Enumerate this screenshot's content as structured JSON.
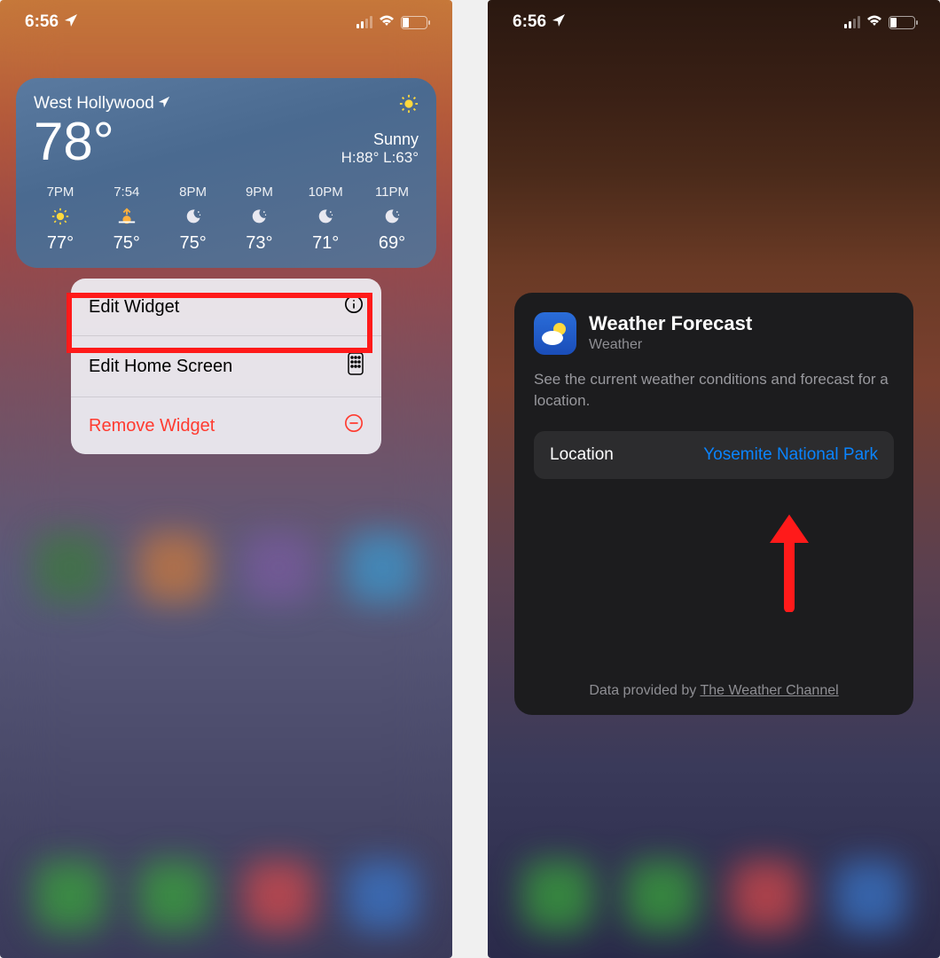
{
  "status": {
    "time": "6:56",
    "signal_active_bars": 2
  },
  "weather": {
    "location": "West Hollywood",
    "current_temp": "78°",
    "condition": "Sunny",
    "high": "H:88°",
    "low": "L:63°",
    "hourly": [
      {
        "time": "7PM",
        "icon": "sun",
        "temp": "77°"
      },
      {
        "time": "7:54",
        "icon": "sunset",
        "temp": "75°"
      },
      {
        "time": "8PM",
        "icon": "night",
        "temp": "75°"
      },
      {
        "time": "9PM",
        "icon": "night",
        "temp": "73°"
      },
      {
        "time": "10PM",
        "icon": "night",
        "temp": "71°"
      },
      {
        "time": "11PM",
        "icon": "night",
        "temp": "69°"
      }
    ]
  },
  "menu": {
    "edit_widget": "Edit Widget",
    "edit_home": "Edit Home Screen",
    "remove": "Remove Widget"
  },
  "config": {
    "title": "Weather Forecast",
    "subtitle": "Weather",
    "description": "See the current weather conditions and forecast for a location.",
    "location_label": "Location",
    "location_value": "Yosemite National Park",
    "footer_prefix": "Data provided by ",
    "footer_link": "The Weather Channel"
  }
}
